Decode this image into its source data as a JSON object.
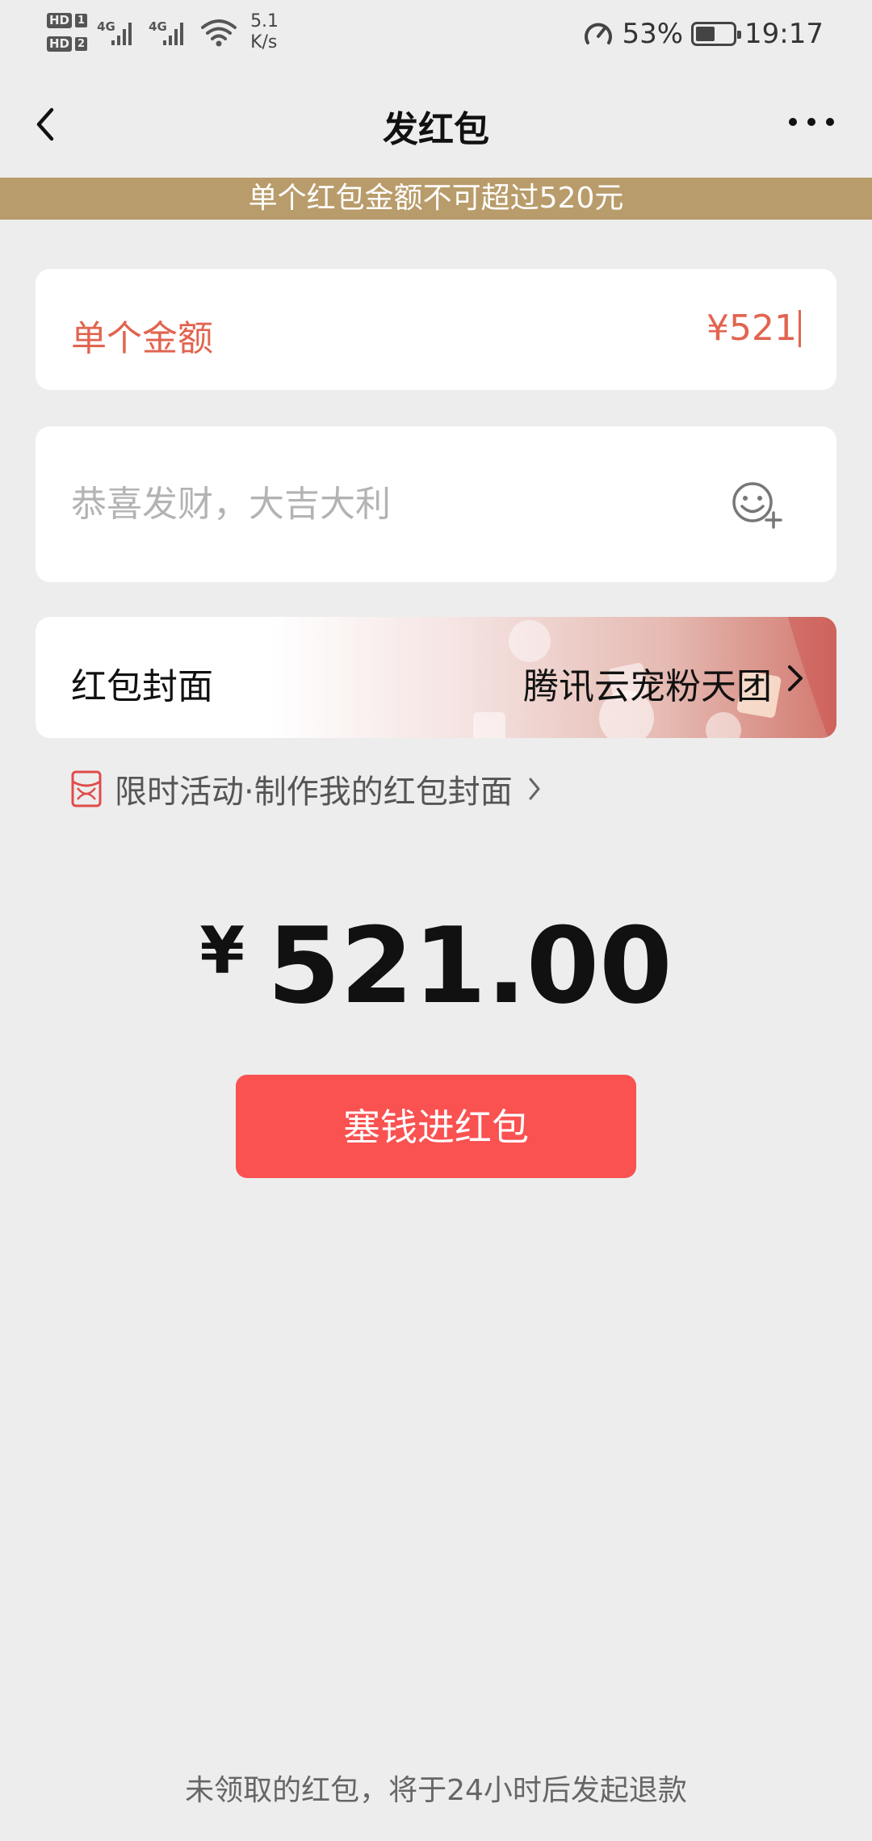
{
  "status_bar": {
    "hd1": "HD",
    "sim1": "1",
    "hd2": "HD",
    "sim2": "2",
    "net1": "4G",
    "net2": "4G",
    "speed_value": "5.1",
    "speed_unit": "K/s",
    "battery_percent": "53%",
    "battery_level": 0.53,
    "time": "19:17"
  },
  "nav": {
    "title": "发红包"
  },
  "notice": {
    "text": "单个红包金额不可超过520元"
  },
  "amount": {
    "label": "单个金额",
    "value": "¥521"
  },
  "greeting": {
    "placeholder": "恭喜发财，大吉大利"
  },
  "cover": {
    "label": "红包封面",
    "value": "腾讯云宠粉天团"
  },
  "promo": {
    "text": "限时活动·制作我的红包封面"
  },
  "total": {
    "currency": "¥",
    "value": "521.00"
  },
  "send_button": {
    "label": "塞钱进红包"
  },
  "footer": {
    "text": "未领取的红包，将于24小时后发起退款"
  },
  "colors": {
    "accent": "#fa5151",
    "notice_bg": "#b99c6b",
    "amount_text": "#e26450",
    "page_bg": "#ededed"
  }
}
